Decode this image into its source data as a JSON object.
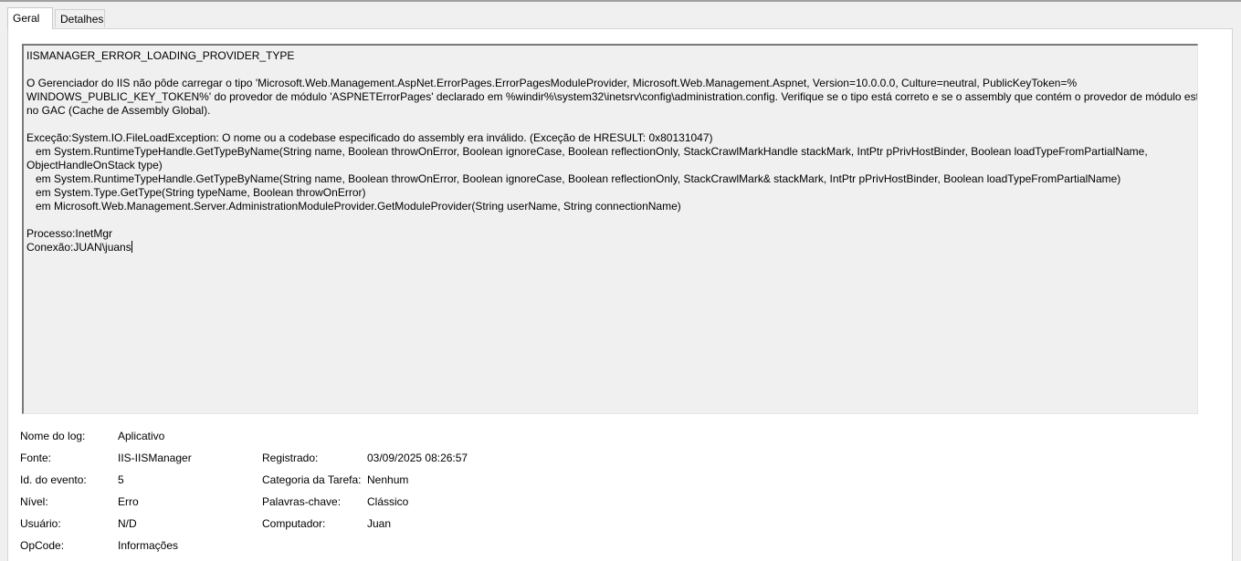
{
  "tabs": [
    {
      "label": "Geral",
      "active": true
    },
    {
      "label": "Detalhes",
      "active": false
    }
  ],
  "message": {
    "lines": [
      "IISMANAGER_ERROR_LOADING_PROVIDER_TYPE",
      "",
      "O Gerenciador do IIS não pôde carregar o tipo 'Microsoft.Web.Management.AspNet.ErrorPages.ErrorPagesModuleProvider, Microsoft.Web.Management.Aspnet, Version=10.0.0.0, Culture=neutral, PublicKeyToken=%",
      "WINDOWS_PUBLIC_KEY_TOKEN%' do provedor de módulo 'ASPNETErrorPages' declarado em %windir%\\system32\\inetsrv\\config\\administration.config. Verifique se o tipo está correto e se o assembly que contém o provedor de módulo está",
      "no GAC (Cache de Assembly Global).",
      "",
      "Exceção:System.IO.FileLoadException: O nome ou a codebase especificado do assembly era inválido. (Exceção de HRESULT: 0x80131047)",
      "   em System.RuntimeTypeHandle.GetTypeByName(String name, Boolean throwOnError, Boolean ignoreCase, Boolean reflectionOnly, StackCrawlMarkHandle stackMark, IntPtr pPrivHostBinder, Boolean loadTypeFromPartialName,",
      "ObjectHandleOnStack type)",
      "   em System.RuntimeTypeHandle.GetTypeByName(String name, Boolean throwOnError, Boolean ignoreCase, Boolean reflectionOnly, StackCrawlMark& stackMark, IntPtr pPrivHostBinder, Boolean loadTypeFromPartialName)",
      "   em System.Type.GetType(String typeName, Boolean throwOnError)",
      "   em Microsoft.Web.Management.Server.AdministrationModuleProvider.GetModuleProvider(String userName, String connectionName)",
      "",
      "Processo:InetMgr",
      "Conexão:JUAN\\juans"
    ]
  },
  "details": {
    "log_name_label": "Nome do log:",
    "log_name_value": "Aplicativo",
    "source_label": "Fonte:",
    "source_value": "IIS-IISManager",
    "logged_label": "Registrado:",
    "logged_value": "03/09/2025 08:26:57",
    "event_id_label": "Id. do evento:",
    "event_id_value": "5",
    "task_category_label": "Categoria da Tarefa:",
    "task_category_value": "Nenhum",
    "level_label": "Nível:",
    "level_value": "Erro",
    "keywords_label": "Palavras-chave:",
    "keywords_value": "Clássico",
    "user_label": "Usuário:",
    "user_value": "N/D",
    "computer_label": "Computador:",
    "computer_value": "Juan",
    "opcode_label": "OpCode:",
    "opcode_value": "Informações"
  }
}
